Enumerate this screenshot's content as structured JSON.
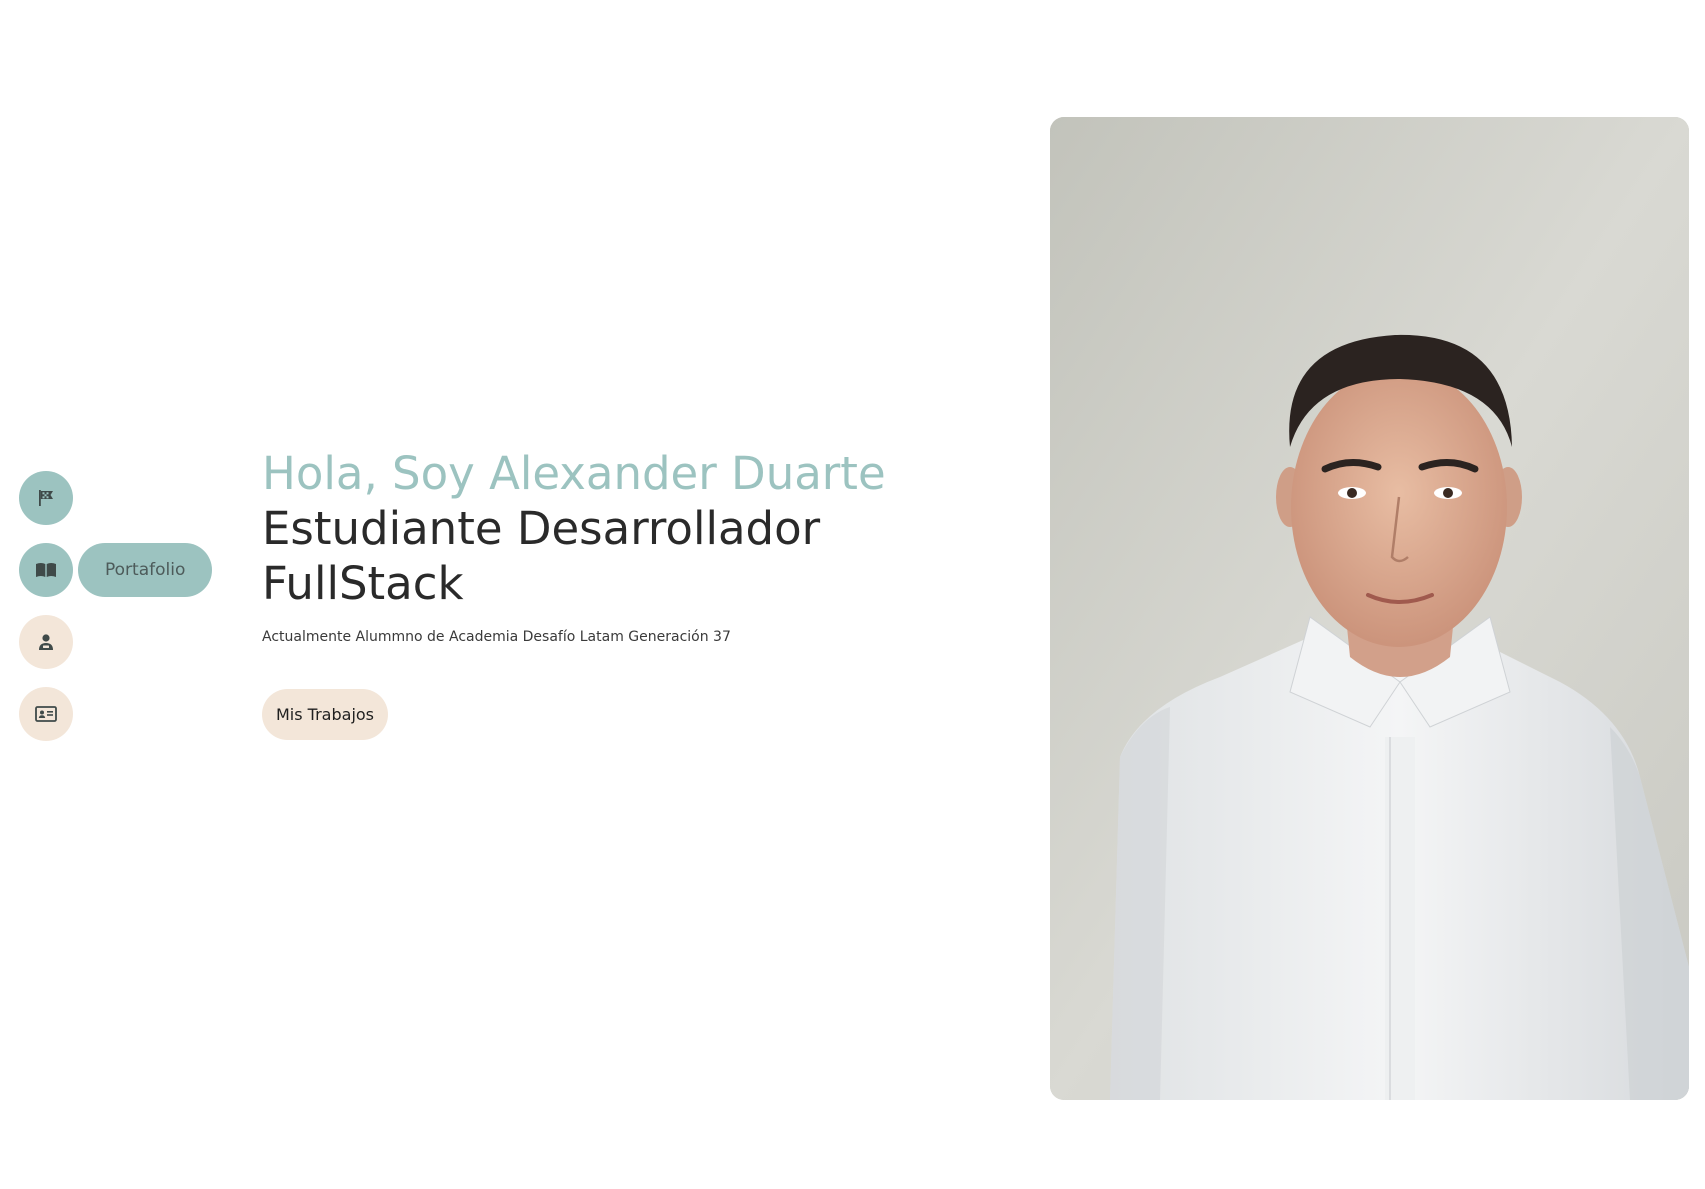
{
  "sidenav": {
    "items": [
      {
        "icon": "flag-icon",
        "label": ""
      },
      {
        "icon": "book-icon",
        "label": "Portafolio",
        "active": true
      },
      {
        "icon": "person-icon",
        "label": ""
      },
      {
        "icon": "id-card-icon",
        "label": ""
      }
    ]
  },
  "hero": {
    "greeting": "Hola, Soy Alexander Duarte",
    "title": "Estudiante Desarrollador FullStack",
    "subtitle": "Actualmente Alummno de Academia Desafío Latam Generación 37",
    "cta_label": "Mis Trabajos"
  },
  "portrait": {
    "alt": "Alexander Duarte"
  },
  "colors": {
    "accent_teal": "#9cc3c0",
    "accent_beige": "#f3e6d9",
    "text_dark": "#2a2a2a"
  }
}
